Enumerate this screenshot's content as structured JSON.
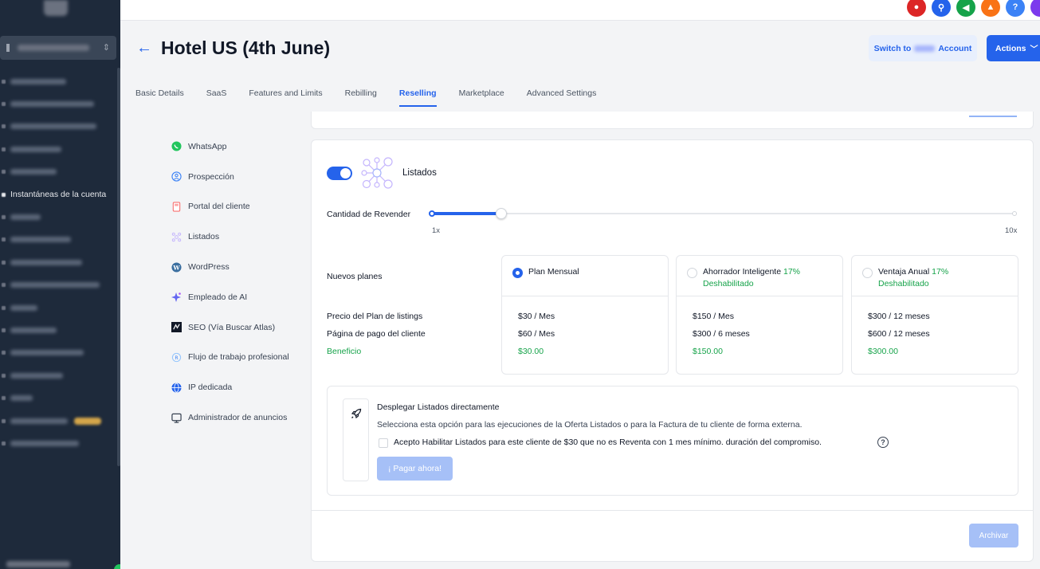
{
  "header": {
    "title": "Hotel US (4th June)",
    "switch_prefix": "Switch to",
    "switch_suffix": "Account",
    "actions_label": "Actions"
  },
  "sidebar": {
    "visible_item": "Instantáneas de la cuenta"
  },
  "tabs": [
    {
      "label": "Basic Details",
      "active": false
    },
    {
      "label": "SaaS",
      "active": false
    },
    {
      "label": "Features and Limits",
      "active": false
    },
    {
      "label": "Rebilling",
      "active": false
    },
    {
      "label": "Reselling",
      "active": true
    },
    {
      "label": "Marketplace",
      "active": false
    },
    {
      "label": "Advanced Settings",
      "active": false
    }
  ],
  "left_nav": [
    {
      "label": "WhatsApp",
      "icon": "whatsapp-icon"
    },
    {
      "label": "Prospección",
      "icon": "prospecting-icon"
    },
    {
      "label": "Portal del cliente",
      "icon": "client-portal-icon"
    },
    {
      "label": "Listados",
      "icon": "listings-icon"
    },
    {
      "label": "WordPress",
      "icon": "wordpress-icon"
    },
    {
      "label": "Empleado de AI",
      "icon": "ai-employee-icon"
    },
    {
      "label": "SEO (Vía Buscar Atlas)",
      "icon": "seo-icon"
    },
    {
      "label": "Flujo de trabajo profesional",
      "icon": "workflow-icon"
    },
    {
      "label": "IP dedicada",
      "icon": "globe-icon"
    },
    {
      "label": "Administrador de anuncios",
      "icon": "ads-manager-icon"
    }
  ],
  "listados": {
    "title": "Listados",
    "enabled": true,
    "slider": {
      "label": "Cantidad de Revender",
      "min_label": "1x",
      "max_label": "10x",
      "value_fraction": 0.12
    },
    "row_labels": {
      "new_plans": "Nuevos planes",
      "plan_price": "Precio del Plan de listings",
      "payment_page": "Página de pago del cliente",
      "profit": "Beneficio"
    },
    "plans": [
      {
        "name": "Plan Mensual",
        "selected": true,
        "percent": "",
        "status": "",
        "price": "$30 / Mes",
        "payment": "$60 / Mes",
        "profit": "$30.00"
      },
      {
        "name": "Ahorrador Inteligente",
        "selected": false,
        "percent": "17%",
        "status": "Deshabilitado",
        "price": "$150 / Mes",
        "payment": "$300 / 6 meses",
        "profit": "$150.00"
      },
      {
        "name": "Ventaja Anual",
        "selected": false,
        "percent": "17%",
        "status": "Deshabilitado",
        "price": "$300 / 12 meses",
        "payment": "$600 / 12 meses",
        "profit": "$300.00"
      }
    ],
    "deploy": {
      "title": "Desplegar Listados directamente",
      "description": "Selecciona esta opción para las ejecuciones de la Oferta Listados o para la Factura de tu cliente de forma externa.",
      "accept_text": "Acepto Habilitar Listados para este cliente de $30 que no es Reventa con 1 mes mínimo. duración del compromiso.",
      "pay_button": "¡ Pagar ahora!"
    },
    "archive_button": "Archivar"
  },
  "colors": {
    "primary": "#2563eb",
    "success": "#16a34a",
    "sidebar": "#1e2a3b"
  }
}
